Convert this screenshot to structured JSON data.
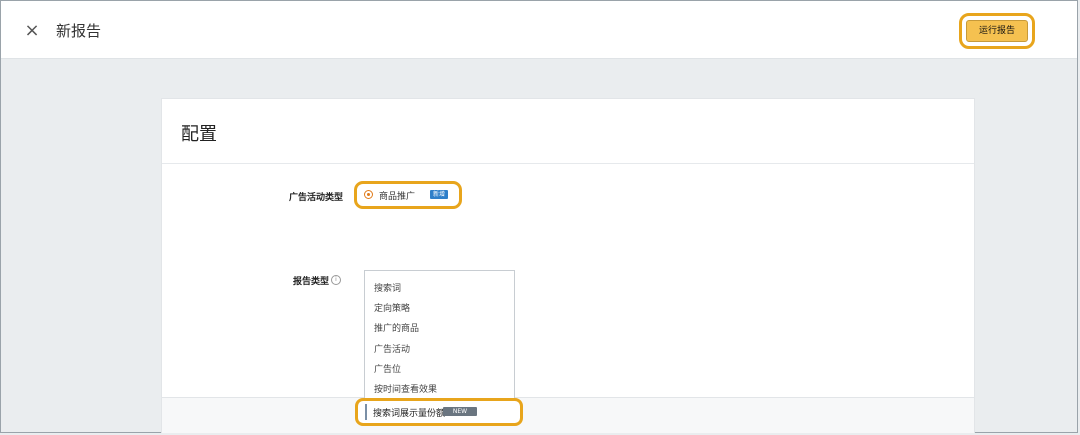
{
  "header": {
    "close_icon": "close-icon",
    "title": "新报告",
    "run_button": "运行报告"
  },
  "config": {
    "title": "配置",
    "campaign_type_label": "广告活动类型",
    "campaign_type_option": "商品推广",
    "campaign_type_badge": "新增",
    "report_type_label": "报告类型",
    "report_types": [
      "搜索词",
      "定向策略",
      "推广的商品",
      "广告活动",
      "广告位",
      "按时间查看效果"
    ],
    "selected_report_type": "搜索词展示量份额",
    "selected_badge": "NEW"
  },
  "colors": {
    "highlight": "#e8a51c",
    "primary_button": "#f5c150",
    "radio_accent": "#e07b1a"
  }
}
